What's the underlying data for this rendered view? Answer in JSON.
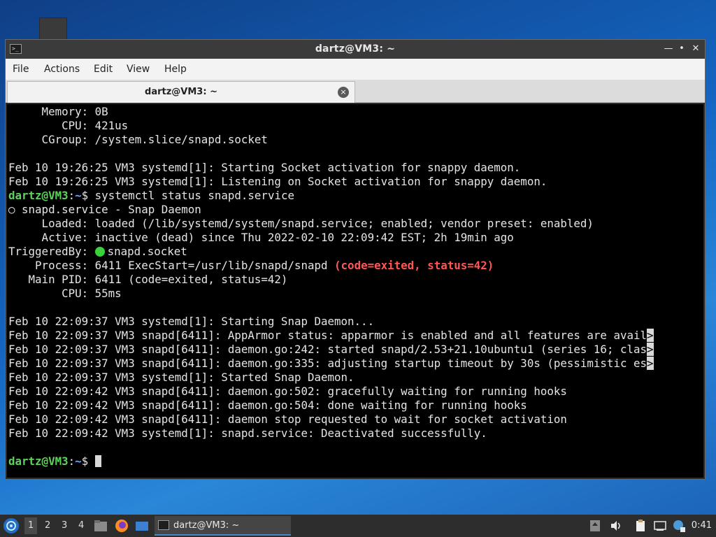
{
  "window": {
    "title": "dartz@VM3: ~",
    "controls": {
      "minimize": "—",
      "maximize": "•",
      "close": "✕"
    }
  },
  "menu": [
    "File",
    "Actions",
    "Edit",
    "View",
    "Help"
  ],
  "tab": {
    "label": "dartz@VM3: ~",
    "close": "×"
  },
  "terminal": {
    "lines": [
      "     Memory: 0B",
      "        CPU: 421us",
      "     CGroup: /system.slice/snapd.socket",
      "",
      "Feb 10 19:26:25 VM3 systemd[1]: Starting Socket activation for snappy daemon.",
      "Feb 10 19:26:25 VM3 systemd[1]: Listening on Socket activation for snappy daemon."
    ],
    "prompt_user": "dartz@VM3",
    "prompt_sep": ":",
    "prompt_path": "~",
    "prompt_symbol": "$",
    "command": " systemctl status snapd.service",
    "service_header": "○ snapd.service - Snap Daemon",
    "loaded": "     Loaded: loaded (/lib/systemd/system/snapd.service; enabled; vendor preset: enabled)",
    "active": "     Active: inactive (dead) since Thu 2022-02-10 22:09:42 EST; 2h 19min ago",
    "triggered_label": "TriggeredBy: ",
    "triggered_value": "snapd.socket",
    "process_prefix": "    Process: 6411 ExecStart=/usr/lib/snapd/snapd ",
    "process_status": "(code=exited, status=42)",
    "main_pid": "   Main PID: 6411 (code=exited, status=42)",
    "cpu2": "        CPU: 55ms",
    "log_lines": [
      "Feb 10 22:09:37 VM3 systemd[1]: Starting Snap Daemon...",
      "Feb 10 22:09:37 VM3 snapd[6411]: AppArmor status: apparmor is enabled and all features are avail",
      "Feb 10 22:09:37 VM3 snapd[6411]: daemon.go:242: started snapd/2.53+21.10ubuntu1 (series 16; clas",
      "Feb 10 22:09:37 VM3 snapd[6411]: daemon.go:335: adjusting startup timeout by 30s (pessimistic es",
      "Feb 10 22:09:37 VM3 systemd[1]: Started Snap Daemon.",
      "Feb 10 22:09:42 VM3 snapd[6411]: daemon.go:502: gracefully waiting for running hooks",
      "Feb 10 22:09:42 VM3 snapd[6411]: daemon.go:504: done waiting for running hooks",
      "Feb 10 22:09:42 VM3 snapd[6411]: daemon stop requested to wait for socket activation",
      "Feb 10 22:09:42 VM3 systemd[1]: snapd.service: Deactivated successfully."
    ],
    "truncation_marker": ">"
  },
  "taskbar": {
    "workspaces": [
      "1",
      "2",
      "3",
      "4"
    ],
    "active_workspace": "1",
    "task_label": "dartz@VM3: ~",
    "clock": "0:41"
  },
  "colors": {
    "prompt_user": "#5ed25e",
    "prompt_path": "#6aa7ff",
    "error": "#ff5555",
    "active_dot": "#3ad13a"
  }
}
